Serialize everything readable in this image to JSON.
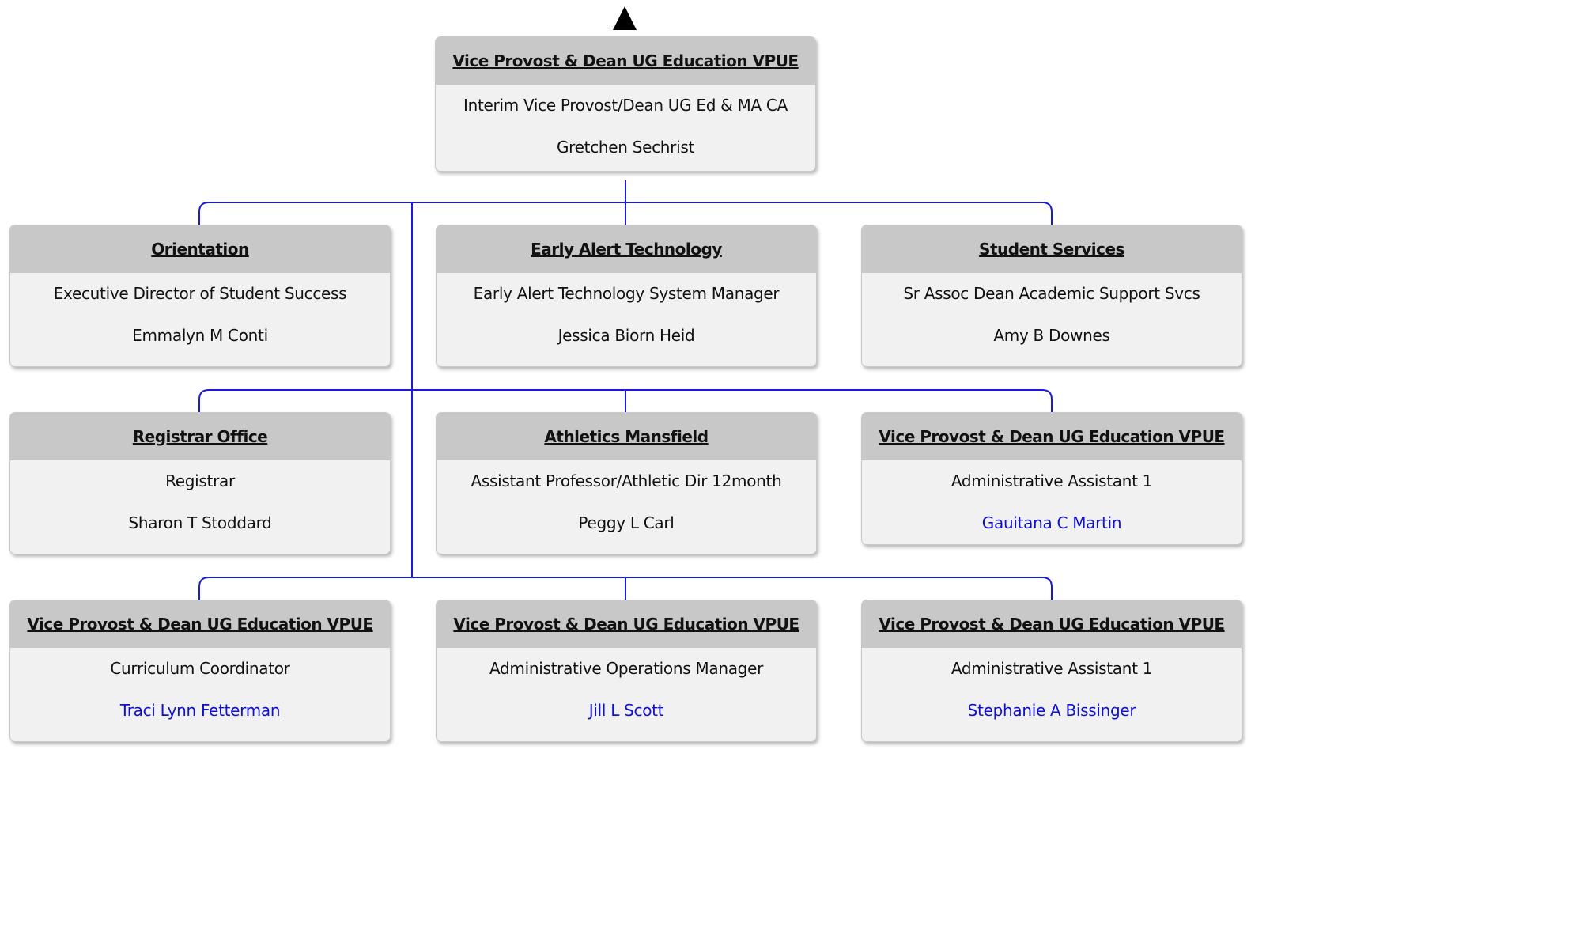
{
  "colors": {
    "connector": "#1a1adc",
    "header": "#c8c8c8",
    "body": "#f1f1f1",
    "link": "#1010d0"
  },
  "nav": {
    "up_icon": "up-arrow-icon"
  },
  "root": {
    "unit": "Vice Provost & Dean UG Education VPUE",
    "title": "Interim Vice Provost/Dean UG Ed & MA CA",
    "person": "Gretchen Sechrist"
  },
  "reports": [
    {
      "unit": "Orientation",
      "title": "Executive Director of Student Success",
      "person": "Emmalyn M Conti"
    },
    {
      "unit": "Early Alert Technology",
      "title": "Early Alert Technology System Manager",
      "person": "Jessica Biorn Heid"
    },
    {
      "unit": "Student Services",
      "title": "Sr Assoc Dean Academic Support Svcs",
      "person": "Amy B Downes"
    },
    {
      "unit": "Registrar Office",
      "title": "Registrar",
      "person": "Sharon T Stoddard"
    },
    {
      "unit": "Athletics Mansfield",
      "title": "Assistant Professor/Athletic Dir 12month",
      "person": "Peggy L Carl"
    },
    {
      "unit": "Vice Provost & Dean UG Education VPUE",
      "title": "Administrative Assistant 1",
      "person": "Gauitana C Martin"
    },
    {
      "unit": "Vice Provost & Dean UG Education VPUE",
      "title": "Curriculum Coordinator",
      "person": "Traci Lynn Fetterman"
    },
    {
      "unit": "Vice Provost & Dean UG Education VPUE",
      "title": "Administrative Operations Manager",
      "person": "Jill L Scott"
    },
    {
      "unit": "Vice Provost & Dean UG Education VPUE",
      "title": "Administrative Assistant 1",
      "person": "Stephanie A Bissinger"
    }
  ]
}
